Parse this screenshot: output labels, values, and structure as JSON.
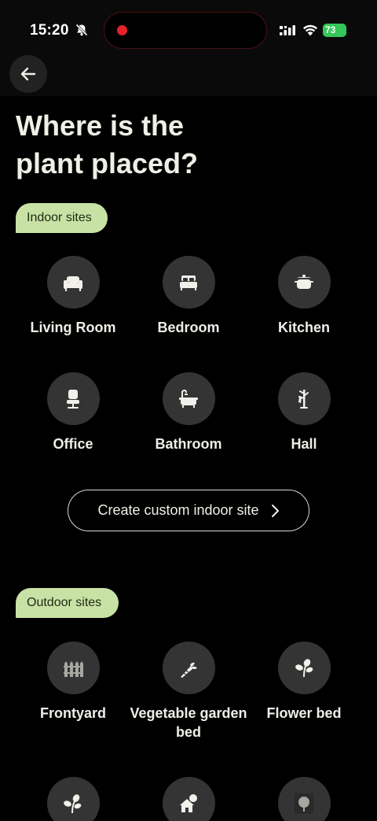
{
  "status_bar": {
    "time": "15:20",
    "battery": "73",
    "icons": [
      "bell-slash-icon",
      "record-dot-icon",
      "cellular-signal-icon",
      "wifi-icon",
      "battery-icon"
    ]
  },
  "header": {
    "back_icon": "arrow-left-icon",
    "title": "Where is the plant placed?"
  },
  "indoor": {
    "chip": "Indoor sites",
    "items": [
      {
        "label": "Living Room",
        "icon": "sofa-icon"
      },
      {
        "label": "Bedroom",
        "icon": "bed-icon"
      },
      {
        "label": "Kitchen",
        "icon": "pot-icon"
      },
      {
        "label": "Office",
        "icon": "office-chair-icon"
      },
      {
        "label": "Bathroom",
        "icon": "bathtub-icon"
      },
      {
        "label": "Hall",
        "icon": "coat-rack-icon"
      }
    ],
    "custom_button": "Create custom indoor site"
  },
  "outdoor": {
    "chip": "Outdoor sites",
    "items": [
      {
        "label": "Frontyard",
        "icon": "fence-icon"
      },
      {
        "label": "Vegetable garden bed",
        "icon": "carrot-icon"
      },
      {
        "label": "Flower bed",
        "icon": "flower-icon"
      },
      {
        "label": "",
        "icon": "leaves-icon"
      },
      {
        "label": "",
        "icon": "house-icon"
      },
      {
        "label": "",
        "icon": "tree-icon"
      }
    ]
  },
  "colors": {
    "background": "#000000",
    "chip_bg": "#c8e2a5",
    "icon_circle": "#343434",
    "text": "#f0efe6",
    "battery": "#34c759",
    "record": "#e4212d"
  }
}
